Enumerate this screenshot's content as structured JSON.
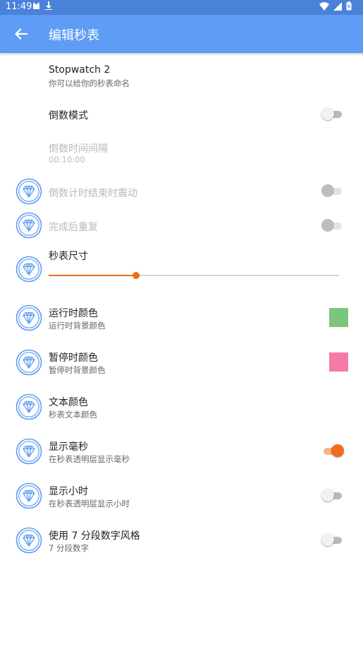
{
  "status_bar": {
    "time": "11:49"
  },
  "app_bar": {
    "title": "编辑秒表"
  },
  "name_setting": {
    "title": "Stopwatch 2",
    "subtitle": "你可以给你的秒表命名"
  },
  "countdown_mode": {
    "title": "倒数模式",
    "on": false
  },
  "countdown_interval": {
    "title": "倒数时间间隔",
    "value": "00:10:00"
  },
  "vibrate_on_end": {
    "title": "倒数计时结束时震动",
    "on": false,
    "enabled": false
  },
  "repeat_after": {
    "title": "完成后重复",
    "on": false,
    "enabled": false
  },
  "size": {
    "title": "秒表尺寸",
    "value_fraction": 0.3
  },
  "running_color": {
    "title": "运行时颜色",
    "subtitle": "运行时背景颜色",
    "color": "#7bc67b"
  },
  "paused_color": {
    "title": "暂停时颜色",
    "subtitle": "暂停时背景颜色",
    "color": "#f47ba8"
  },
  "text_color": {
    "title": "文本颜色",
    "subtitle": "秒表文本颜色"
  },
  "show_millis": {
    "title": "显示毫秒",
    "subtitle": "在秒表透明层显示毫秒",
    "on": true
  },
  "show_hours": {
    "title": "显示小时",
    "subtitle": "在秒表透明层显示小时",
    "on": false
  },
  "seven_segment": {
    "title": "使用 7 分段数字风格",
    "subtitle": "7 分段数字",
    "on": false
  },
  "colors": {
    "primary": "#5e9cf5",
    "status_bar": "#4a82da",
    "accent": "#ef6c1a"
  },
  "icons": {
    "back": "arrow-left-icon",
    "pro": "diamond-icon"
  }
}
